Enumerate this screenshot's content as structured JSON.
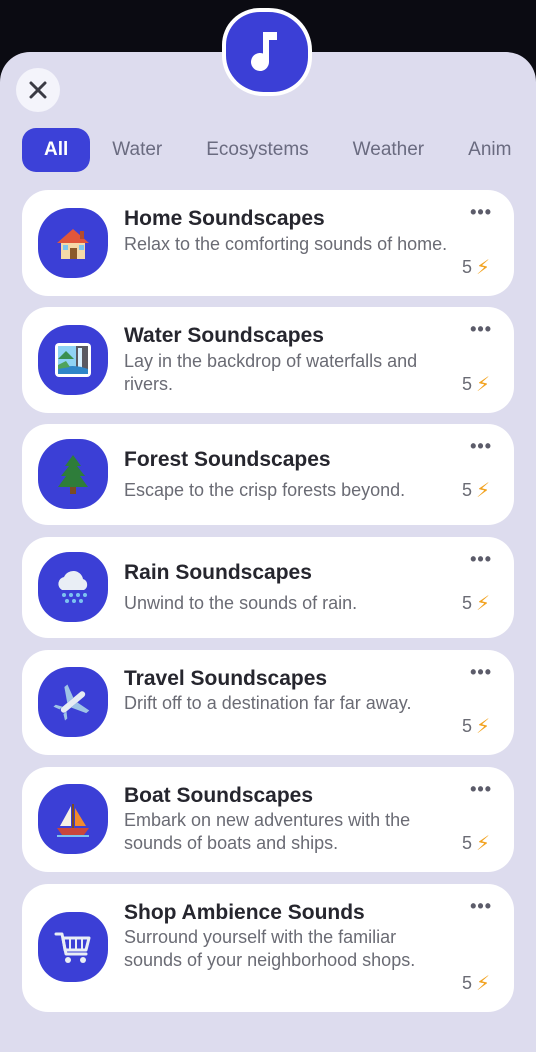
{
  "header": {
    "badge_icon": "music-note-icon",
    "close_icon": "close-icon"
  },
  "tabs": [
    {
      "label": "All",
      "active": true
    },
    {
      "label": "Water",
      "active": false
    },
    {
      "label": "Ecosystems",
      "active": false
    },
    {
      "label": "Weather",
      "active": false
    },
    {
      "label": "Anim",
      "active": false
    }
  ],
  "soundscapes": [
    {
      "title": "Home Soundscapes",
      "description": "Relax to the comforting sounds of home.",
      "cost": "5",
      "icon": "house-icon"
    },
    {
      "title": "Water Soundscapes",
      "description": "Lay in the backdrop of waterfalls and rivers.",
      "cost": "5",
      "icon": "waterfall-icon"
    },
    {
      "title": "Forest Soundscapes",
      "description": "Escape to the crisp forests beyond.",
      "cost": "5",
      "icon": "pine-tree-icon"
    },
    {
      "title": "Rain Soundscapes",
      "description": "Unwind to the sounds of rain.",
      "cost": "5",
      "icon": "rain-cloud-icon"
    },
    {
      "title": "Travel Soundscapes",
      "description": "Drift off to a destination far far away.",
      "cost": "5",
      "icon": "airplane-icon"
    },
    {
      "title": "Boat Soundscapes",
      "description": "Embark on new adventures with the sounds of boats and ships.",
      "cost": "5",
      "icon": "sailboat-icon"
    },
    {
      "title": "Shop Ambience Sounds",
      "description": "Surround yourself with the familiar sounds of your neighborhood shops.",
      "cost": "5",
      "icon": "shopping-cart-icon"
    }
  ],
  "colors": {
    "accent": "#3c41d8",
    "sheet": "#dddcee",
    "bolt": "#f2a321"
  }
}
